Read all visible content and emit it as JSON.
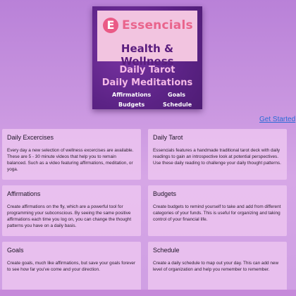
{
  "header": {
    "logo_letter": "E",
    "brand": "Essencials",
    "tagline": "Health & Wellness",
    "features": [
      "Daily Tarot",
      "Daily Meditations"
    ],
    "minor_features": [
      "Affirmations",
      "Goals",
      "Budgets",
      "Schedule"
    ]
  },
  "cta": {
    "label": "Get Started"
  },
  "cards": [
    {
      "title": "Daily Excercises",
      "body": "Every day a new selection of wellness excercises are available. These are 5 - 30 minute videos that help you to remain balanced. Such as a video featuring affirmations, meditation, or yoga."
    },
    {
      "title": "Daily Tarot",
      "body": "Essencials features a handmade traditional tarot deck with daily readings to gain an introspective look at potential perspectives. Use these daily reading to challenge your daily thought patterns."
    },
    {
      "title": "Affirmations",
      "body": "Create affirmations on the fly, which are a powerful tool for programming your subconscious. By seeing the same positive affirmations each time you log on, you can change the thought patterns you have on a daily basis."
    },
    {
      "title": "Budgets",
      "body": "Create budgets to remind yourself to take and add from different categories of your funds. This is useful for organizing and taking control of your financial life."
    },
    {
      "title": "Goals",
      "body": "Create goals, much like affirmations, but save your goals forever to see how far you've come and your direction."
    },
    {
      "title": "Schedule",
      "body": "Create a daily schedule to map out your day. This can add new level of organization and help you remember to remember."
    }
  ],
  "colors": {
    "accent": "#e9648c",
    "header_purple": "#6a2a8f",
    "link": "#2a6ad6"
  }
}
